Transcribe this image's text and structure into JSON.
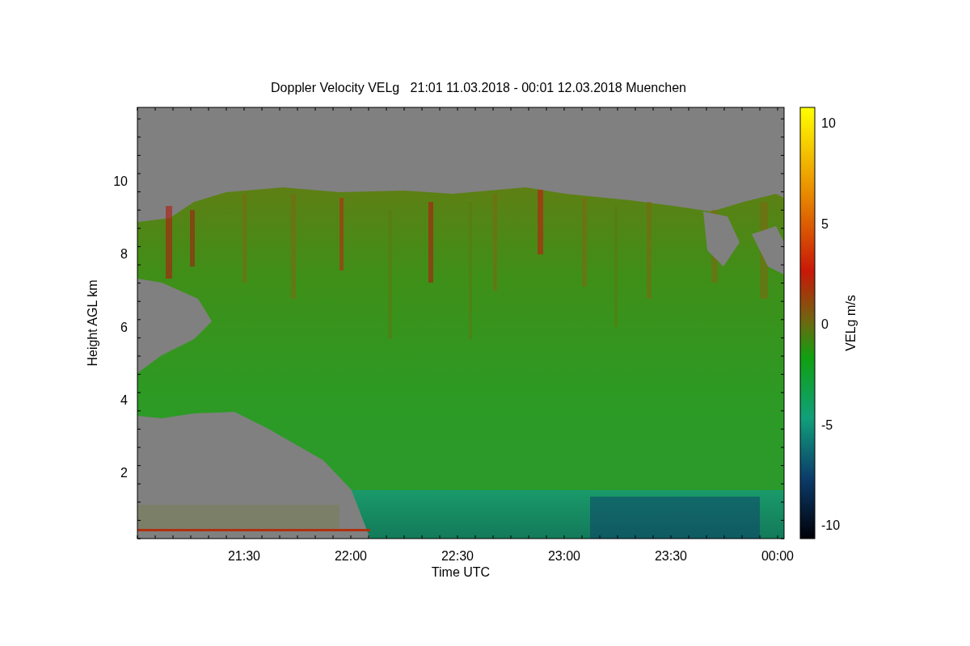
{
  "title": "Doppler Velocity VELg   21:01 11.03.2018 - 00:01 12.03.2018 Muenchen",
  "plot": {
    "xlabel": "Time UTC",
    "ylabel": "Height AGL km",
    "xticks": [
      "21:30",
      "22:00",
      "22:30",
      "23:00",
      "23:30",
      "00:00"
    ],
    "yticks": [
      "10",
      "8",
      "6",
      "4",
      "2"
    ]
  },
  "colorbar": {
    "label": "VELg m/s",
    "ticks": [
      "10",
      "5",
      "0",
      "-5",
      "-10"
    ]
  }
}
